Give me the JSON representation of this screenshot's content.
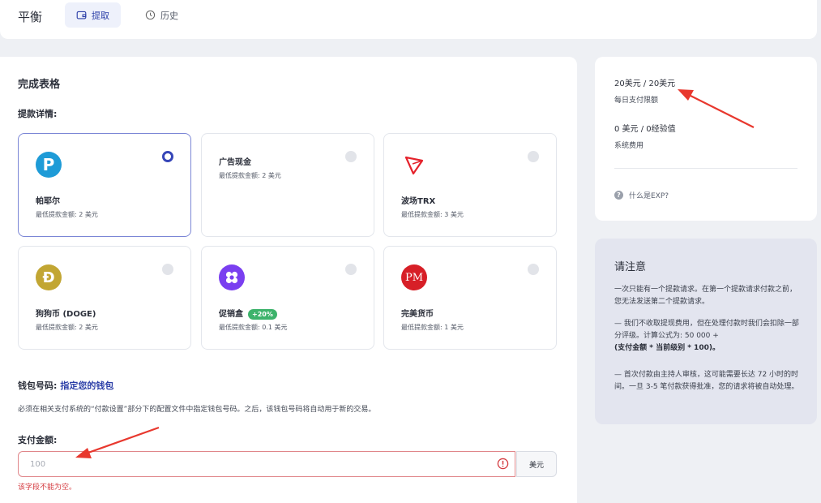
{
  "header": {
    "brand": "平衡",
    "tabs": [
      {
        "label": "提取",
        "active": true
      },
      {
        "label": "历史",
        "active": false
      }
    ]
  },
  "form": {
    "title": "完成表格",
    "details_label": "提款详情:",
    "methods": [
      {
        "name": "帕耶尔",
        "min": "最低提款金额: 2 美元",
        "icon": "payeer-icon",
        "selected": true
      },
      {
        "name": "广告现金",
        "min": "最低提款金额: 2 美元",
        "icon": "none",
        "selected": false
      },
      {
        "name": "波场TRX",
        "min": "最低提款金额: 3 美元",
        "icon": "tron-icon",
        "selected": false
      },
      {
        "name": "狗狗币 (DOGE)",
        "min": "最低提款金额: 2 美元",
        "icon": "dogecoin-icon",
        "selected": false
      },
      {
        "name": "促销盒",
        "badge": "+20%",
        "min": "最低提款金额: 0.1 美元",
        "icon": "promo-box-icon",
        "selected": false
      },
      {
        "name": "完美货币",
        "min": "最低提款金额: 1 美元",
        "icon": "perfect-money-icon",
        "selected": false
      }
    ],
    "wallet_label": "钱包号码:",
    "wallet_link": "指定您的钱包",
    "wallet_desc": "必须在相关支付系统的“付款设置”部分下的配置文件中指定钱包号码。之后，该钱包号码将自动用于新的交易。",
    "amount_label": "支付金额:",
    "amount_placeholder": "100",
    "amount_unit": "美元",
    "error": "该字段不能为空。"
  },
  "limits": {
    "daily_value": "20美元 / 20美元",
    "daily_label": "每日支付限额",
    "fee_value": "0 美元 / 0经验值",
    "fee_label": "系统费用",
    "exp_link": "什么是EXP?"
  },
  "notice": {
    "title": "请注意",
    "p1": "一次只能有一个提款请求。在第一个提款请求付款之前，您无法发送第二个提款请求。",
    "p2a": "— 我们不收取提现费用，但在处理付款时我们会扣除一部分评级。计算公式为: 50 000 +",
    "p2b": "(支付金额 * 当前级别 * 100)。",
    "p3": "— 首次付款由主持人审核，这可能需要长达 72 小时的时间。一旦 3-5 笔付款获得批准，您的请求将被自动处理。"
  },
  "colors": {
    "accent": "#2c3fa8",
    "payeer": "#1e9bd7",
    "tron": "#e5232c",
    "doge": "#c2a633",
    "promo": "#7a3ff0",
    "perfect_money": "#d71f27",
    "error": "#d43a3f",
    "badge": "#3db36b"
  }
}
